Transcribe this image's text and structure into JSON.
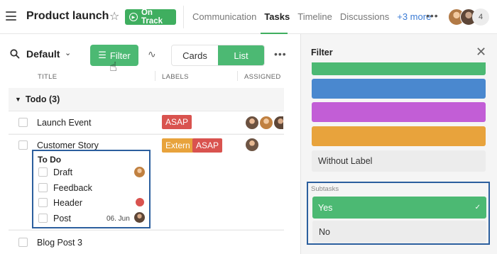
{
  "header": {
    "title": "Product launch",
    "status": "On Track",
    "tabs": [
      "Communication",
      "Tasks",
      "Timeline",
      "Discussions"
    ],
    "more_tabs": "+3 more",
    "member_count": "4"
  },
  "toolbar": {
    "view_name": "Default",
    "filter_label": "Filter",
    "cards_label": "Cards",
    "list_label": "List"
  },
  "columns": {
    "title": "TITLE",
    "labels": "LABELS",
    "assigned": "ASSIGNED"
  },
  "section": {
    "name": "Todo (3)"
  },
  "tasks": [
    {
      "title": "Launch Event",
      "labels": [
        "ASAP"
      ]
    },
    {
      "title": "Customer Story",
      "labels": [
        "Extern",
        "ASAP"
      ]
    },
    {
      "title": "Blog Post 3",
      "labels": []
    }
  ],
  "subtasks": {
    "header": "To Do",
    "items": [
      {
        "label": "Draft",
        "date": ""
      },
      {
        "label": "Feedback",
        "date": ""
      },
      {
        "label": "Header",
        "date": ""
      },
      {
        "label": "Post",
        "date": "06. Jun"
      }
    ]
  },
  "filter_panel": {
    "title": "Filter",
    "label_colors": [
      "#4cb973",
      "#4a88cf",
      "#c25ed6",
      "#e8a33c"
    ],
    "without_label": "Without Label",
    "subtasks_label": "Subtasks",
    "yes_label": "Yes",
    "no_label": "No"
  },
  "colors": {
    "accent": "#4cb973",
    "asap": "#d9534f",
    "extern": "#e8a33c",
    "highlight": "#2c5f9e"
  }
}
